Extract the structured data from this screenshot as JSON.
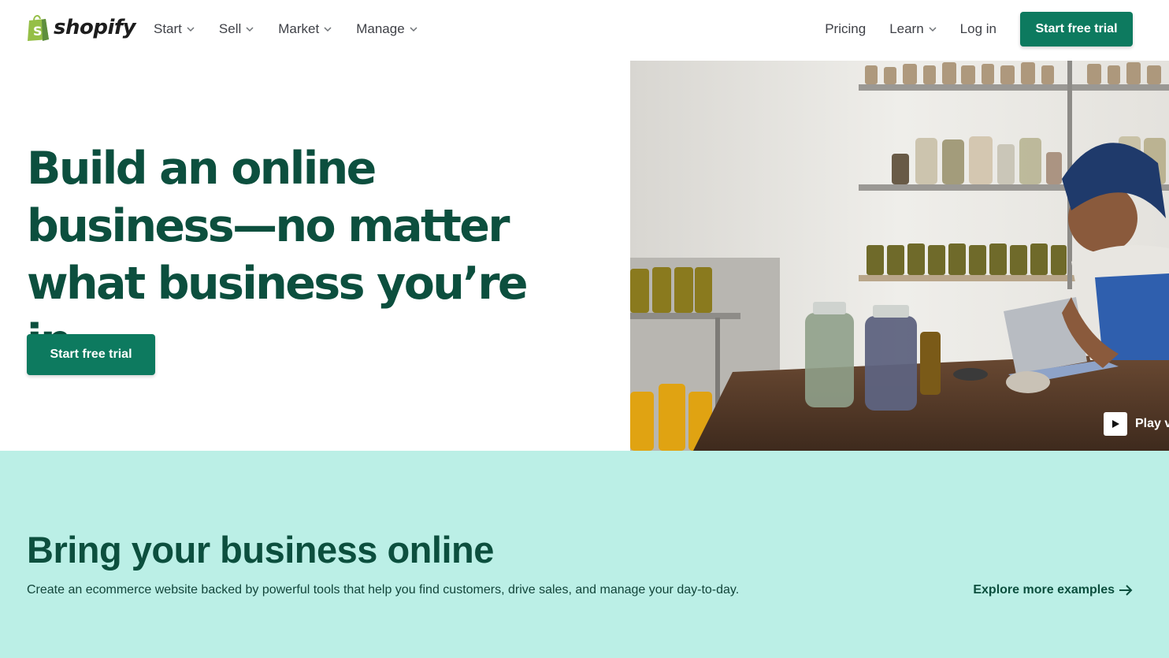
{
  "brand": {
    "name": "shopify",
    "icon": "shopping-bag-logo-icon",
    "bag_color": "#95bf47"
  },
  "nav": {
    "left_items": [
      {
        "label": "Start",
        "icon": "chevron-down-icon"
      },
      {
        "label": "Sell",
        "icon": "chevron-down-icon"
      },
      {
        "label": "Market",
        "icon": "chevron-down-icon"
      },
      {
        "label": "Manage",
        "icon": "chevron-down-icon"
      }
    ],
    "pricing": "Pricing",
    "learn": "Learn",
    "login": "Log in",
    "cta": "Start free trial"
  },
  "hero": {
    "title": "Build an online business—no matter what business you’re in",
    "cta": "Start free trial",
    "play_label": "Play v",
    "play_icon": "play-icon"
  },
  "section": {
    "title": "Bring your business online",
    "description": "Create an ecommerce website backed by powerful tools that help you find customers, drive sales, and manage your day-to-day.",
    "link": "Explore more examples",
    "link_icon": "arrow-right-icon"
  },
  "colors": {
    "primary_green": "#0d7a5f",
    "heading_green": "#0c4f3e",
    "mint_background": "#bbefe6"
  }
}
